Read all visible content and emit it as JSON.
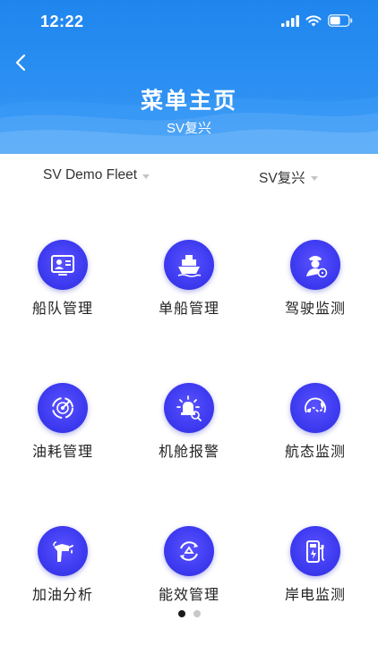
{
  "status": {
    "time": "12:22"
  },
  "header": {
    "title": "菜单主页",
    "subtitle": "SV复兴"
  },
  "filters": {
    "fleet": "SV Demo Fleet",
    "ship": "SV复兴"
  },
  "menu": [
    {
      "label": "船队管理",
      "icon": "fleet-management-icon"
    },
    {
      "label": "单船管理",
      "icon": "ship-icon"
    },
    {
      "label": "驾驶监测",
      "icon": "captain-icon"
    },
    {
      "label": "油耗管理",
      "icon": "radar-icon"
    },
    {
      "label": "机舱报警",
      "icon": "alarm-icon"
    },
    {
      "label": "航态监测",
      "icon": "route-icon"
    },
    {
      "label": "加油分析",
      "icon": "fuel-nozzle-icon"
    },
    {
      "label": "能效管理",
      "icon": "efficiency-icon"
    },
    {
      "label": "岸电监测",
      "icon": "charging-station-icon"
    }
  ],
  "pagination": {
    "current": 1,
    "total": 2
  },
  "colors": {
    "header": "#2b8ff2",
    "icon_bg": "#3d3af0"
  }
}
